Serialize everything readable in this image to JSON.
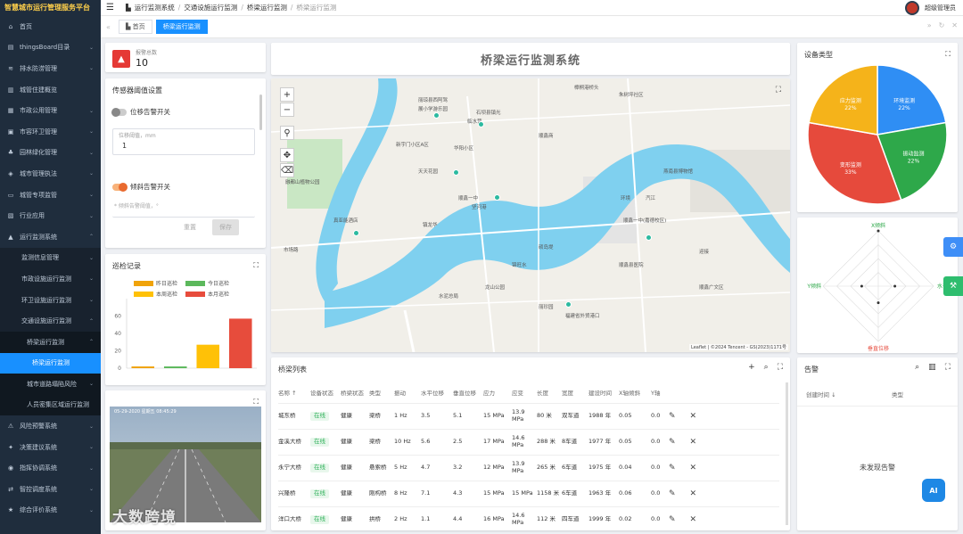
{
  "app_title": "智慧城市运行管理服务平台",
  "sidebar": {
    "items": [
      {
        "label": "首页",
        "level": 0,
        "icon": "home-icon",
        "arrow": ""
      },
      {
        "label": "thingsBoard目录",
        "level": 0,
        "icon": "folder-icon",
        "arrow": "⌄"
      },
      {
        "label": "排水防涝管理",
        "level": 0,
        "icon": "water-icon",
        "arrow": "⌄"
      },
      {
        "label": "城管住建概览",
        "level": 0,
        "icon": "chart-icon",
        "arrow": ""
      },
      {
        "label": "市政公用管理",
        "level": 0,
        "icon": "building-icon",
        "arrow": "⌄"
      },
      {
        "label": "市容环卫管理",
        "level": 0,
        "icon": "trash-icon",
        "arrow": "⌄"
      },
      {
        "label": "园林绿化管理",
        "level": 0,
        "icon": "tree-icon",
        "arrow": "⌄"
      },
      {
        "label": "城市管理执法",
        "level": 0,
        "icon": "badge-icon",
        "arrow": "⌄"
      },
      {
        "label": "城管专项监管",
        "level": 0,
        "icon": "monitor-icon",
        "arrow": "⌄"
      },
      {
        "label": "行业应用",
        "level": 0,
        "icon": "app-icon",
        "arrow": "⌄"
      },
      {
        "label": "运行监测系统",
        "level": 0,
        "icon": "pulse-icon",
        "arrow": "⌃"
      },
      {
        "label": "监测信息管理",
        "level": 1,
        "icon": "",
        "arrow": "⌄"
      },
      {
        "label": "市政设施运行监测",
        "level": 1,
        "icon": "",
        "arrow": "⌄"
      },
      {
        "label": "环卫设施运行监测",
        "level": 1,
        "icon": "",
        "arrow": "⌄"
      },
      {
        "label": "交通设施运行监测",
        "level": 1,
        "icon": "",
        "arrow": "⌃"
      },
      {
        "label": "桥梁运行监测",
        "level": 2,
        "icon": "",
        "arrow": "⌃"
      },
      {
        "label": "桥梁运行监测",
        "level": 3,
        "icon": "",
        "arrow": "",
        "active": true
      },
      {
        "label": "城市道路塌陷风险",
        "level": 2,
        "icon": "",
        "arrow": "⌄"
      },
      {
        "label": "人员密集区域运行监测",
        "level": 2,
        "icon": "",
        "arrow": ""
      },
      {
        "label": "风险预警系统",
        "level": 0,
        "icon": "warning-icon",
        "arrow": "⌄"
      },
      {
        "label": "决策建议系统",
        "level": 0,
        "icon": "bulb-icon",
        "arrow": "⌄"
      },
      {
        "label": "指挥协调系统",
        "level": 0,
        "icon": "command-icon",
        "arrow": "⌄"
      },
      {
        "label": "智控调度系统",
        "level": 0,
        "icon": "dispatch-icon",
        "arrow": "⌄"
      },
      {
        "label": "综合评价系统",
        "level": 0,
        "icon": "star-icon",
        "arrow": "⌄"
      }
    ]
  },
  "topbar": {
    "breadcrumb": [
      "运行监测系统",
      "交通设施运行监测",
      "桥梁运行监测",
      "桥梁运行监测"
    ],
    "user": "超级管理员"
  },
  "tags": [
    {
      "label": "首页"
    },
    {
      "label": "桥梁运行监测"
    }
  ],
  "alarm": {
    "label": "报警总数",
    "value": "10"
  },
  "sensor": {
    "title": "传感器阈值设置",
    "displacement_switch": "位移告警开关",
    "displacement_label": "位移阈值，mm",
    "displacement_value": "1",
    "tilt_switch": "倾斜告警开关",
    "tilt_placeholder": "* 倾斜告警阈值，°",
    "reset": "重置",
    "save": "保存"
  },
  "inspection": {
    "title": "巡检记录",
    "legend": [
      "昨日巡检",
      "今日巡检",
      "本周巡检",
      "本月巡检"
    ]
  },
  "chart_data": [
    {
      "type": "bar",
      "categories": [
        "昨日巡检",
        "今日巡检",
        "本周巡检",
        "本月巡检"
      ],
      "values": [
        2,
        2,
        27,
        57
      ],
      "colors": [
        "#f0a30a",
        "#5cb85c",
        "#ffc107",
        "#e74c3c"
      ],
      "yticks": [
        0,
        20,
        40,
        60
      ],
      "ylim": [
        0,
        80
      ]
    },
    {
      "type": "pie",
      "title": "设备类型",
      "slices": [
        {
          "name": "环境监测",
          "percent": 22,
          "color": "#2f8ef4"
        },
        {
          "name": "振动监测",
          "percent": 22,
          "color": "#2ea84a"
        },
        {
          "name": "变形监测",
          "percent": 33,
          "color": "#e64a3c"
        },
        {
          "name": "应力监测",
          "percent": 22,
          "color": "#f5b31a"
        }
      ]
    },
    {
      "type": "radar",
      "axes": [
        "X倾斜",
        "Y倾斜",
        "垂直位移",
        "水平位移"
      ],
      "values": [
        1,
        0.3,
        0.3,
        0.3
      ]
    }
  ],
  "camera": {
    "timestamp": "05-29-2020 星期五 08:45:29"
  },
  "banner": "桥梁运行监测系统",
  "map": {
    "attribution": "Leaflet | ©2024 Tencent - GS(2023)1171号",
    "labels": [
      "樟桐港桥头",
      "朱树坪社区",
      "丽琼县西阿驾",
      "展小学游乐园",
      "石坝县镇光",
      "临水营",
      "顺鑫商",
      "新宇门小区A区",
      "华阳小区",
      "天天花园",
      "顺鑫一中",
      "坚河港",
      "融都山植物公园",
      "真亚能酒店",
      "镇龙华",
      "锦旺水",
      "环境",
      "汽江",
      "顺鑫一中(嘉德校区)",
      "燕南县博物馆",
      "硕岛堤",
      "龙山公园",
      "顺鑫县医院",
      "顺鑫广文区",
      "丽珍园",
      "水泥总局",
      "福建省外贸港口",
      "迎接",
      "市场路"
    ]
  },
  "bridge_table": {
    "title": "桥梁列表",
    "headers": [
      "名称 ↑",
      "设备状态",
      "桥梁状态",
      "类型",
      "振动",
      "水平位移",
      "垂直位移",
      "应力",
      "应变",
      "长度",
      "宽度",
      "建设时间",
      "X轴倾斜",
      "Y轴"
    ],
    "rows": [
      [
        "城东桥",
        "在线",
        "健康",
        "梁桥",
        "1 Hz",
        "3.5",
        "5.1",
        "15 MPa",
        "13.9 MPa",
        "80 米",
        "双车道",
        "1988 年",
        "0.05",
        "0.0"
      ],
      [
        "金溪大桥",
        "在线",
        "健康",
        "梁桥",
        "10 Hz",
        "5.6",
        "2.5",
        "17 MPa",
        "14.6 MPa",
        "288 米",
        "8车道",
        "1977 年",
        "0.05",
        "0.0"
      ],
      [
        "永宁大桥",
        "在线",
        "健康",
        "悬索桥",
        "5 Hz",
        "4.7",
        "3.2",
        "12 MPa",
        "13.9 MPa",
        "265 米",
        "6车道",
        "1975 年",
        "0.04",
        "0.0"
      ],
      [
        "兴隆桥",
        "在线",
        "健康",
        "刚构桥",
        "8 Hz",
        "7.1",
        "4.3",
        "15 MPa",
        "15 MPa",
        "1158 米",
        "6车道",
        "1963 年",
        "0.06",
        "0.0"
      ],
      [
        "洋口大桥",
        "在线",
        "健康",
        "拱桥",
        "2 Hz",
        "1.1",
        "4.4",
        "16 MPa",
        "14.6 MPa",
        "112 米",
        "四车道",
        "1999 年",
        "0.02",
        "0.0"
      ]
    ]
  },
  "alarm_panel": {
    "title": "告警",
    "col_time": "创建时间 ↓",
    "col_type": "类型",
    "empty": "未发现告警"
  },
  "watermark": "大数跨境"
}
